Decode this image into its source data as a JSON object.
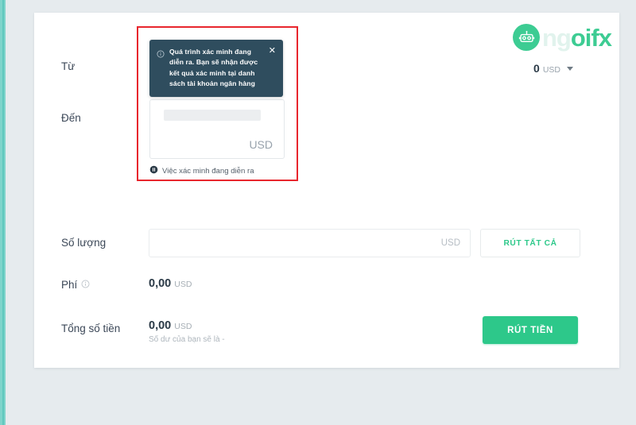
{
  "brand": {
    "logo_icon": "robot-icon",
    "name_pale": "ng",
    "name_solid": "oifx"
  },
  "balance": {
    "value": "0",
    "currency": "USD",
    "caret_icon": "chevron-down-icon"
  },
  "form": {
    "from": {
      "label": "Từ"
    },
    "to": {
      "label": "Đến",
      "currency": "USD",
      "placeholder_skeleton": true,
      "note_icon": "pause-circle-icon",
      "note": "Việc xác minh đang diễn ra"
    },
    "tooltip": {
      "icon": "info-circle-icon",
      "message": "Quá trình xác minh đang diễn ra. Bạn sẽ nhận được kết quả xác minh tại danh sách tài khoản ngân hàng",
      "close_icon": "close-icon",
      "close_label": "✕"
    },
    "amount": {
      "label": "Số lượng",
      "value": "",
      "placeholder": "",
      "currency": "USD",
      "withdraw_all_label": "RÚT TẤT CẢ"
    },
    "fee": {
      "label": "Phí",
      "info_icon": "info-circle-icon",
      "value": "0,00",
      "currency": "USD"
    },
    "total": {
      "label": "Tổng số tiền",
      "value": "0,00",
      "currency": "USD",
      "balance_note": "Số dư của bạn sẽ là -"
    },
    "submit": {
      "label": "RÚT TIỀN"
    }
  },
  "colors": {
    "accent_green": "#2dc88a",
    "tooltip_bg": "#2f4d5e",
    "highlight_red": "#e8262d",
    "page_bg": "#e6ebee"
  }
}
